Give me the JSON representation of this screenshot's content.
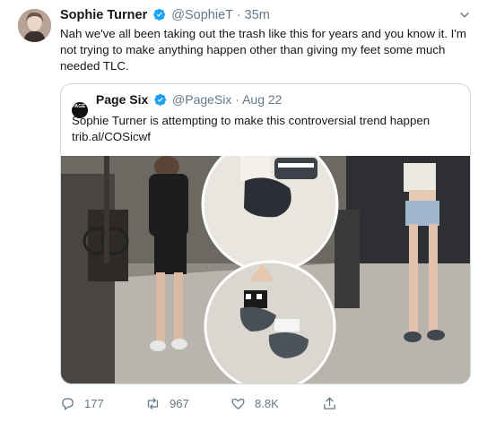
{
  "tweet": {
    "author_name": "Sophie Turner",
    "author_handle": "@SophieT",
    "separator": "·",
    "time": "35m",
    "text": "Nah we've all been taking out the trash like this for years and you know it. I'm not trying to make anything happen other than giving my feet some much needed TLC."
  },
  "quote": {
    "logo_text": "PAGE SIX",
    "author_name": "Page Six",
    "author_handle": "@PageSix",
    "separator": "·",
    "date": "Aug 22",
    "text": "Sophie Turner is attempting to make this controversial trend happen",
    "link": "trib.al/COSicwf"
  },
  "actions": {
    "replies": "177",
    "retweets": "967",
    "likes": "8.8K"
  },
  "colors": {
    "verified": "#1da1f2",
    "secondary_text": "#657786",
    "border": "#ccd6dd"
  },
  "icons": [
    "verified-badge-icon",
    "chevron-down-icon",
    "reply-icon",
    "retweet-icon",
    "like-icon",
    "share-icon"
  ]
}
